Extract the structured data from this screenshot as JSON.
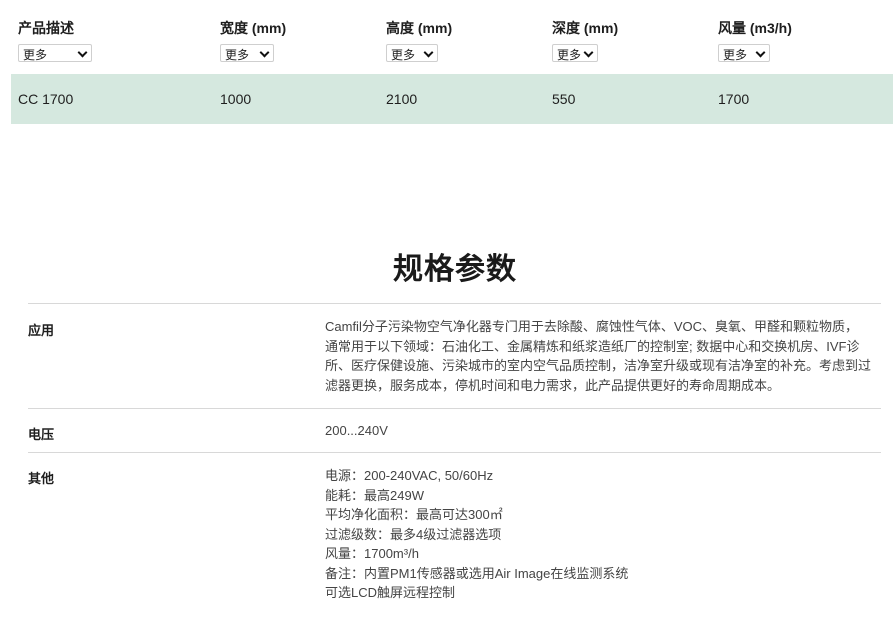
{
  "table": {
    "columns": [
      {
        "title": "产品描述",
        "select": "更多"
      },
      {
        "title": "宽度 (mm)",
        "select": "更多"
      },
      {
        "title": "高度 (mm)",
        "select": "更多"
      },
      {
        "title": "深度 (mm)",
        "select": "更多"
      },
      {
        "title": "风量 (m3/h)",
        "select": "更多"
      }
    ],
    "row": [
      "CC 1700",
      "1000",
      "2100",
      "550",
      "1700"
    ],
    "row_color": "#d5e8df"
  },
  "specs": {
    "title": "规格参数",
    "items": [
      {
        "label": "应用",
        "lines": [
          "Camfil分子污染物空气净化器专门用于去除酸、腐蚀性气体、VOC、臭氧、甲醛和颗粒物质，",
          "通常用于以下领域：石油化工、金属精炼和纸浆造纸厂的控制室; 数据中心和交换机房、IVF诊",
          "所、医疗保健设施、污染城市的室内空气品质控制，洁净室升级或现有洁净室的补充。考虑到过",
          "滤器更换，服务成本，停机时间和电力需求，此产品提供更好的寿命周期成本。"
        ]
      },
      {
        "label": "电压",
        "lines": [
          "200...240V"
        ]
      },
      {
        "label": "其他",
        "lines": [
          "电源：200-240VAC, 50/60Hz",
          "能耗：最高249W",
          "平均净化面积：最高可达300㎡",
          "过滤级数：最多4级过滤器选项",
          "风量：1700m³/h",
          "备注：内置PM1传感器或选用Air Image在线监测系统",
          "可选LCD触屏远程控制"
        ]
      }
    ]
  }
}
